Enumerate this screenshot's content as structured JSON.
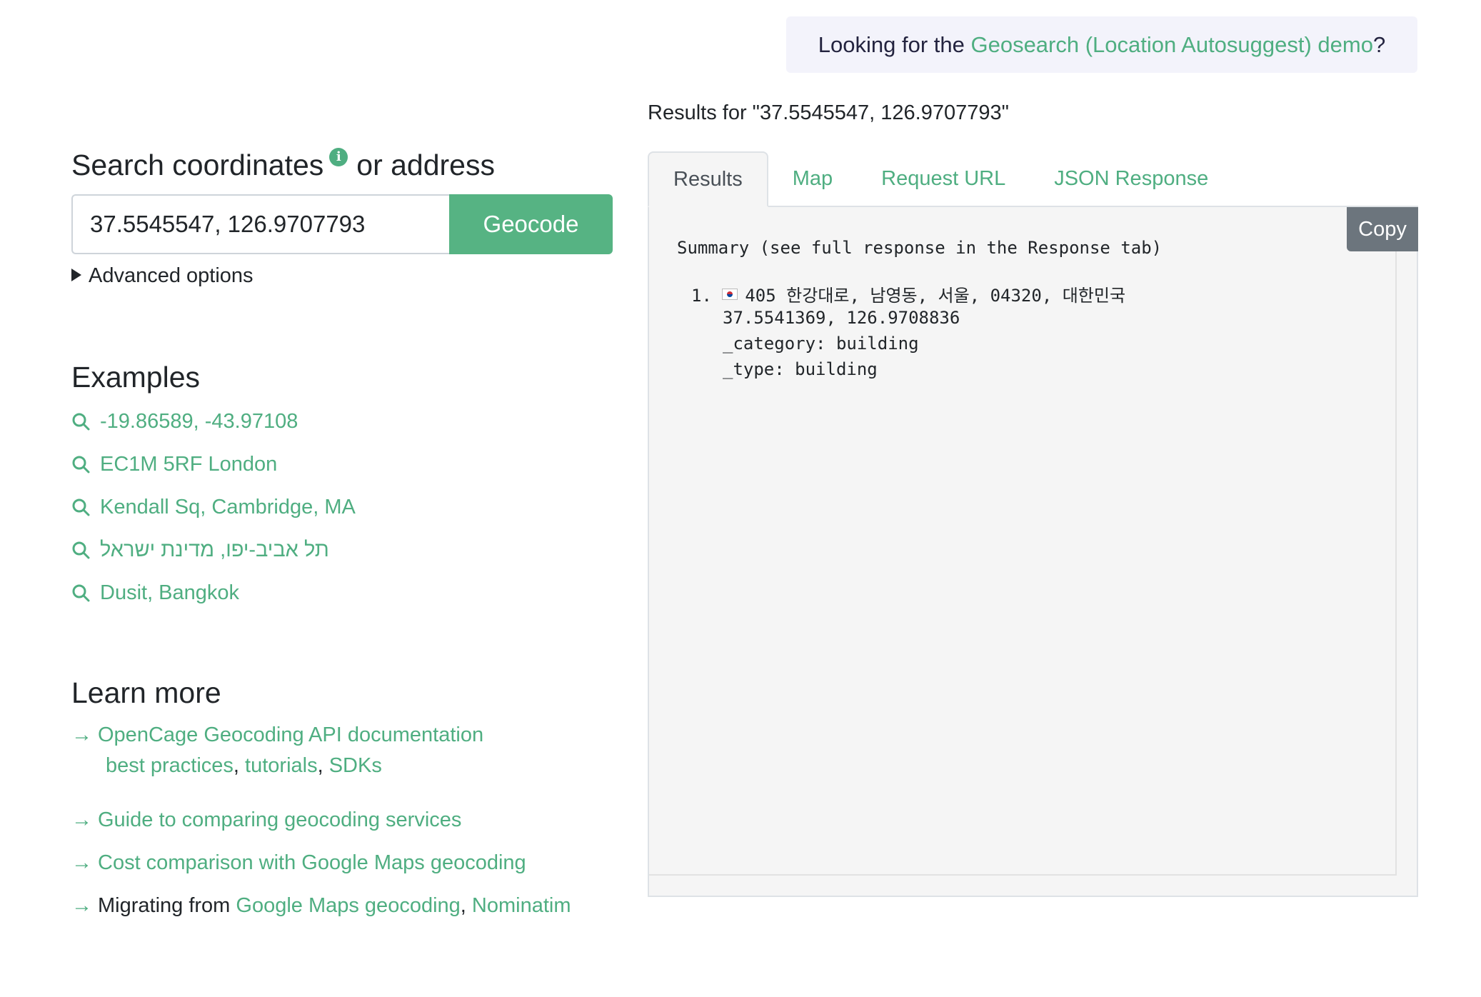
{
  "notice": {
    "prefix": "Looking for the ",
    "link": "Geosearch (Location Autosuggest) demo",
    "suffix": "?"
  },
  "search": {
    "title_part1": "Search coordinates",
    "info_icon": "info-icon",
    "title_part2": "or address",
    "input_value": "37.5545547, 126.9707793",
    "button_label": "Geocode",
    "advanced_label": "Advanced options"
  },
  "examples": {
    "title": "Examples",
    "items": [
      "-19.86589, -43.97108",
      "EC1M 5RF London",
      "Kendall Sq, Cambridge, MA",
      "תל אביב-יפו, מדינת ישראל",
      "Dusit, Bangkok"
    ]
  },
  "learn_more": {
    "title": "Learn more",
    "doc_link": "OpenCage Geocoding API documentation",
    "sub_links": [
      "best practices",
      "tutorials",
      "SDKs"
    ],
    "sep": ", ",
    "guide": "Guide to comparing geocoding services",
    "cost": "Cost comparison with Google Maps geocoding",
    "migrating_prefix": "Migrating from ",
    "migrating_links": [
      "Google Maps geocoding",
      "Nominatim"
    ]
  },
  "results": {
    "header": "Results for \"37.5545547, 126.9707793\"",
    "tabs": [
      "Results",
      "Map",
      "Request URL",
      "JSON Response"
    ],
    "copy_label": "Copy",
    "summary": "Summary (see full response in the Response tab)",
    "item_number": "1.",
    "item_flag": "flag-icon-south-korea",
    "item_address": "405 한강대로, 남영동, 서울, 04320, 대한민국",
    "item_coords": "37.5541369, 126.9708836",
    "item_category": "_category: building",
    "item_type": "_type: building"
  },
  "colors": {
    "accent": "#4fae81",
    "button": "#56b383",
    "notice_bg": "#f3f3fb",
    "panel_bg": "#f5f5f5",
    "copy_bg": "#6c757d"
  }
}
